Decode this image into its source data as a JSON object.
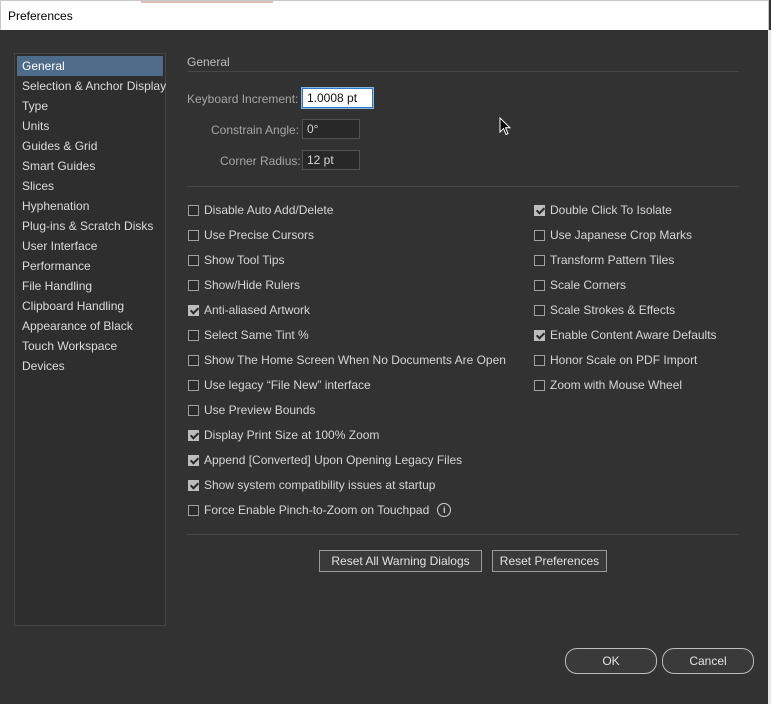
{
  "window": {
    "title": "Preferences"
  },
  "sidebar": {
    "items": [
      "General",
      "Selection & Anchor Display",
      "Type",
      "Units",
      "Guides & Grid",
      "Smart Guides",
      "Slices",
      "Hyphenation",
      "Plug-ins & Scratch Disks",
      "User Interface",
      "Performance",
      "File Handling",
      "Clipboard Handling",
      "Appearance of Black",
      "Touch Workspace",
      "Devices"
    ],
    "selected": "General"
  },
  "general": {
    "section_title": "General",
    "keyboard_increment": {
      "label": "Keyboard Increment:",
      "value": "1.0008 pt"
    },
    "constrain_angle": {
      "label": "Constrain Angle:",
      "value": "0°"
    },
    "corner_radius": {
      "label": "Corner Radius:",
      "value": "12 pt"
    },
    "left_options": [
      {
        "label": "Disable Auto Add/Delete",
        "checked": false
      },
      {
        "label": "Use Precise Cursors",
        "checked": false
      },
      {
        "label": "Show Tool Tips",
        "checked": false
      },
      {
        "label": "Show/Hide Rulers",
        "checked": false
      },
      {
        "label": "Anti-aliased Artwork",
        "checked": true
      },
      {
        "label": "Select Same Tint %",
        "checked": false
      },
      {
        "label": "Show The Home Screen When No Documents Are Open",
        "checked": false
      },
      {
        "label": "Use legacy “File New” interface",
        "checked": false
      },
      {
        "label": "Use Preview Bounds",
        "checked": false
      },
      {
        "label": "Display Print Size at 100% Zoom",
        "checked": true
      },
      {
        "label": "Append [Converted] Upon Opening Legacy Files",
        "checked": true
      },
      {
        "label": "Show system compatibility issues at startup",
        "checked": true
      },
      {
        "label": "Force Enable Pinch-to-Zoom on Touchpad",
        "checked": false
      }
    ],
    "right_options": [
      {
        "label": "Double Click To Isolate",
        "checked": true
      },
      {
        "label": "Use Japanese Crop Marks",
        "checked": false
      },
      {
        "label": "Transform Pattern Tiles",
        "checked": false
      },
      {
        "label": "Scale Corners",
        "checked": false
      },
      {
        "label": "Scale Strokes & Effects",
        "checked": false
      },
      {
        "label": "Enable Content Aware Defaults",
        "checked": true
      },
      {
        "label": "Honor Scale on PDF Import",
        "checked": false
      },
      {
        "label": "Zoom with Mouse Wheel",
        "checked": false
      }
    ],
    "info_icon_glyph": "i"
  },
  "buttons": {
    "reset_warnings": "Reset All Warning Dialogs",
    "reset_prefs": "Reset Preferences",
    "ok": "OK",
    "cancel": "Cancel"
  },
  "colors": {
    "background": "#323232",
    "selected_item": "#4f6b8a",
    "active_field_border": "#2f79c8"
  }
}
